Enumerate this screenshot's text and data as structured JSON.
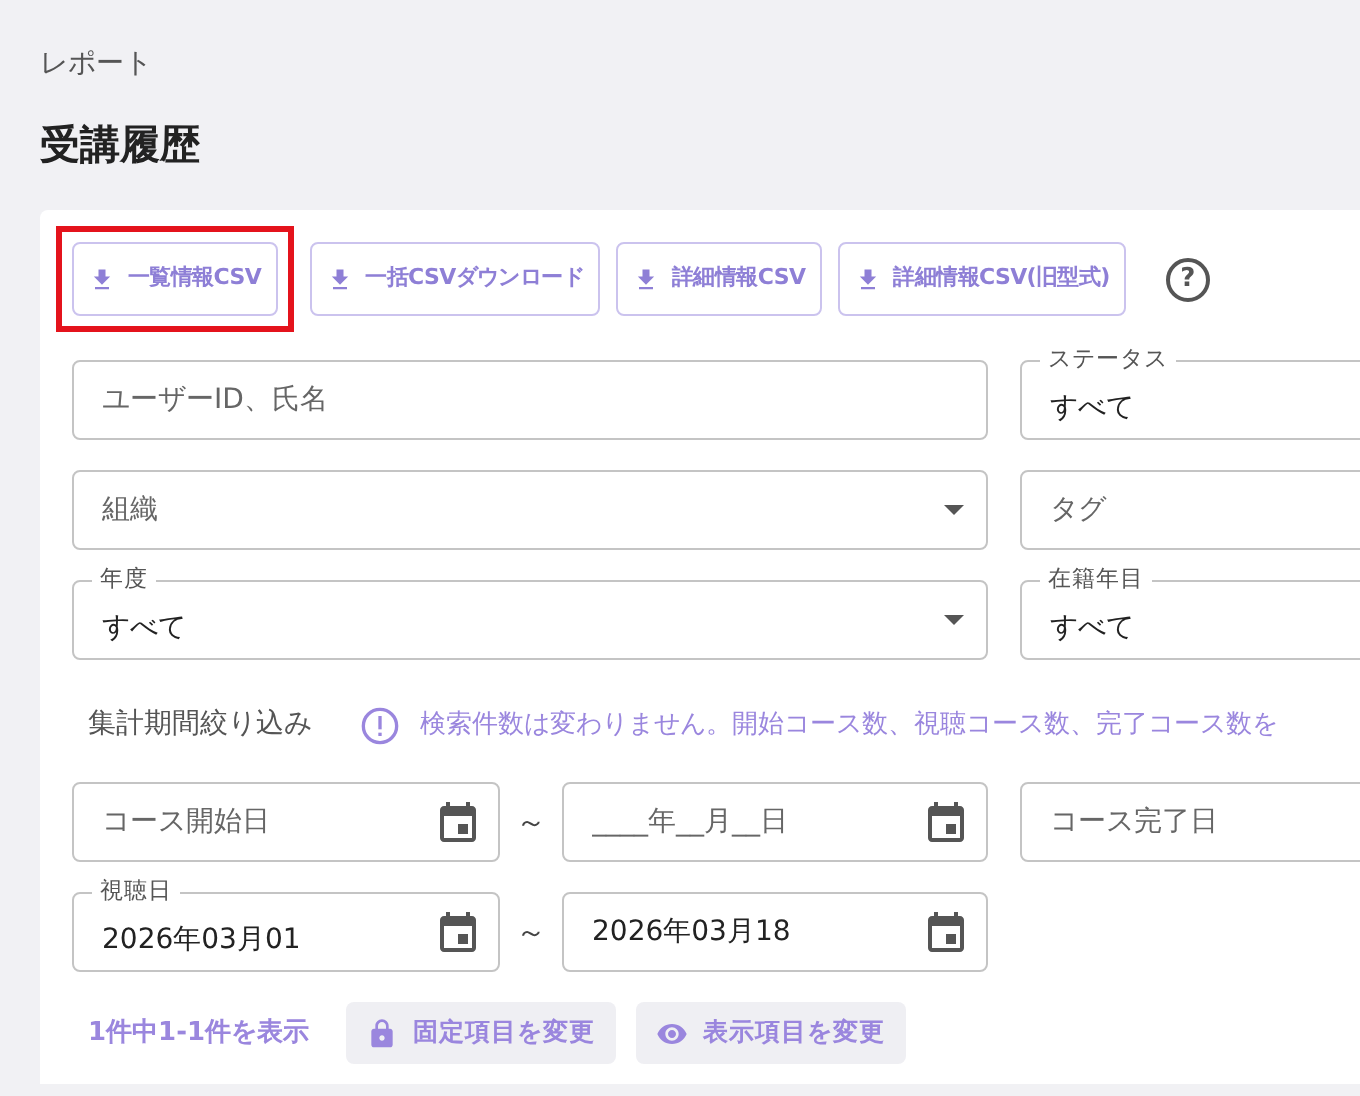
{
  "breadcrumb": "レポート",
  "title": "受講履歴",
  "toolbar": [
    {
      "label": "一覧情報CSV",
      "highlighted": true
    },
    {
      "label": "一括CSVダウンロード",
      "highlighted": false
    },
    {
      "label": "詳細情報CSV",
      "highlighted": false
    },
    {
      "label": "詳細情報CSV(旧型式)",
      "highlighted": false
    }
  ],
  "help": "?",
  "filters": [
    [
      {
        "kind": "text",
        "placeholder": "ユーザーID、氏名"
      },
      {
        "kind": "text",
        "label": "ステータス",
        "value": "すべて"
      }
    ],
    [
      {
        "kind": "select",
        "placeholder": "組織"
      },
      {
        "kind": "text",
        "placeholder": "タグ"
      }
    ],
    [
      {
        "kind": "select",
        "label": "年度",
        "value": "すべて"
      },
      {
        "kind": "text",
        "label": "在籍年目",
        "value": "すべて"
      }
    ]
  ],
  "period": {
    "label": "集計期間絞り込み",
    "note": "検索件数は変わりません。開始コース数、視聴コース数、完了コース数を"
  },
  "date_rows": [
    {
      "from": {
        "placeholder": "コース開始日"
      },
      "separator": "～",
      "to": {
        "placeholder": "____年__月__日"
      },
      "extra": {
        "placeholder": "コース完了日"
      }
    },
    {
      "from": {
        "label": "視聴日",
        "value": "2026年03月01"
      },
      "separator": "～",
      "to": {
        "value": "2026年03月18"
      }
    }
  ],
  "result_count": "1件中1-1件を表示",
  "footer_buttons": [
    {
      "kind": "lock",
      "label": "固定項目を変更"
    },
    {
      "kind": "eye",
      "label": "表示項目を変更"
    }
  ]
}
